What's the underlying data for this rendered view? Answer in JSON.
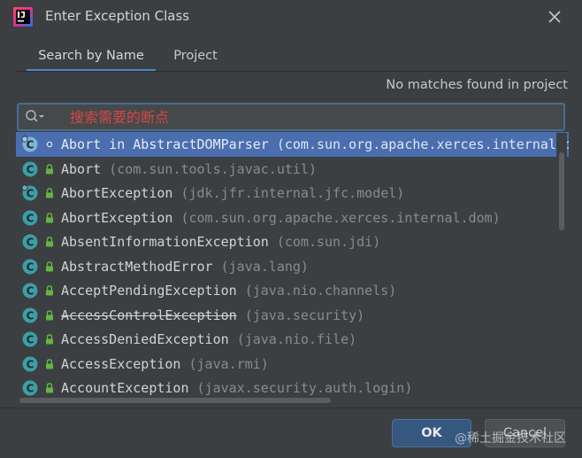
{
  "window": {
    "title": "Enter Exception Class",
    "app_icon": "intellij-idea-icon",
    "close_icon": "close-icon"
  },
  "tabs": [
    {
      "label": "Search by Name",
      "active": true
    },
    {
      "label": "Project",
      "active": false
    }
  ],
  "status": "No matches found in project",
  "search": {
    "value": "",
    "placeholder": "搜索需要的断点",
    "icon": "search-icon"
  },
  "list": {
    "items": [
      {
        "name": "Abort in AbstractDOMParser",
        "package": "(com.sun.org.apache.xerces.internal.parsers)",
        "icon": "inner-class-icon",
        "visibility": "private-dot",
        "selected": true,
        "deprecated": false
      },
      {
        "name": "Abort",
        "package": "(com.sun.tools.javac.util)",
        "icon": "class-icon",
        "visibility": "public-lock",
        "selected": false,
        "deprecated": false
      },
      {
        "name": "AbortException",
        "package": "(jdk.jfr.internal.jfc.model)",
        "icon": "inner-class-icon",
        "visibility": "public-lock",
        "selected": false,
        "deprecated": false
      },
      {
        "name": "AbortException",
        "package": "(com.sun.org.apache.xerces.internal.dom)",
        "icon": "class-icon",
        "visibility": "public-lock",
        "selected": false,
        "deprecated": false
      },
      {
        "name": "AbsentInformationException",
        "package": "(com.sun.jdi)",
        "icon": "class-icon",
        "visibility": "public-lock",
        "selected": false,
        "deprecated": false
      },
      {
        "name": "AbstractMethodError",
        "package": "(java.lang)",
        "icon": "class-icon",
        "visibility": "public-lock",
        "selected": false,
        "deprecated": false
      },
      {
        "name": "AcceptPendingException",
        "package": "(java.nio.channels)",
        "icon": "class-icon",
        "visibility": "public-lock",
        "selected": false,
        "deprecated": false
      },
      {
        "name": "AccessControlException",
        "package": "(java.security)",
        "icon": "class-icon",
        "visibility": "public-lock",
        "selected": false,
        "deprecated": true
      },
      {
        "name": "AccessDeniedException",
        "package": "(java.nio.file)",
        "icon": "class-icon",
        "visibility": "public-lock",
        "selected": false,
        "deprecated": false
      },
      {
        "name": "AccessException",
        "package": "(java.rmi)",
        "icon": "class-icon",
        "visibility": "public-lock",
        "selected": false,
        "deprecated": false
      },
      {
        "name": "AccountException",
        "package": "(javax.security.auth.login)",
        "icon": "class-icon",
        "visibility": "public-lock",
        "selected": false,
        "deprecated": false
      }
    ]
  },
  "buttons": {
    "ok": "OK",
    "cancel": "Cancel"
  },
  "watermark": "@稀土掘金技术社区",
  "colors": {
    "accent": "#4a88c7",
    "selection": "#4b6eaf",
    "placeholder_red": "#d64545",
    "class_icon": "#42a0a8",
    "lock_icon": "#62b543"
  }
}
